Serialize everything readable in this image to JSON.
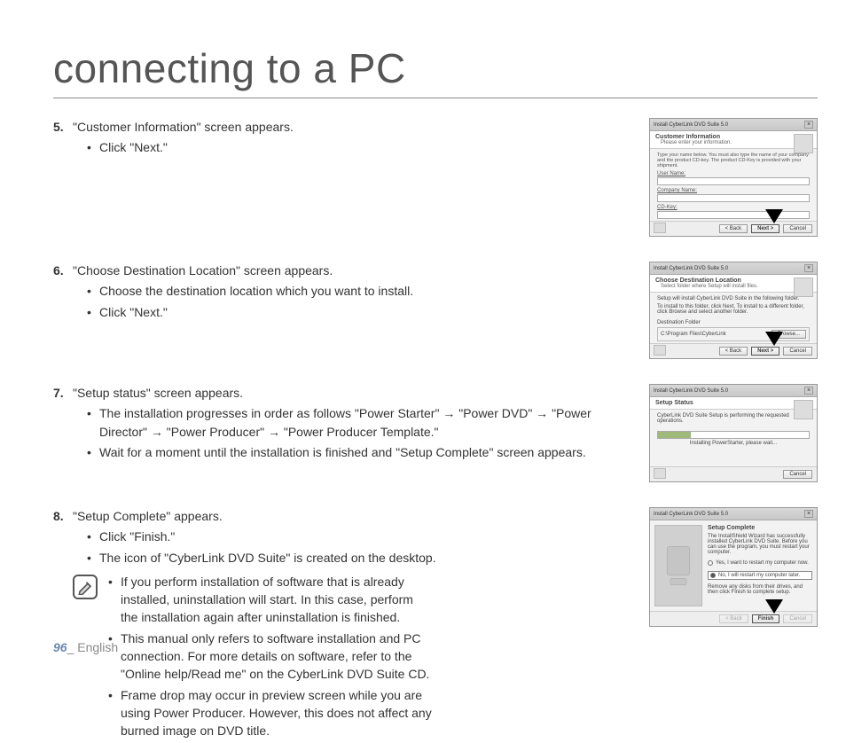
{
  "page": {
    "title": "connecting to a PC",
    "number": "96",
    "lang": "_ English"
  },
  "steps": {
    "s5": {
      "num": "5.",
      "head": "\"Customer Information\" screen appears.",
      "b1": "Click \"Next.\""
    },
    "s6": {
      "num": "6.",
      "head": "\"Choose Destination Location\" screen appears.",
      "b1": "Choose the destination location which you want to install.",
      "b2": "Click \"Next.\""
    },
    "s7": {
      "num": "7.",
      "head": "\"Setup status\" screen appears.",
      "b1": "The installation progresses in order as follows \"Power Starter\" → \"Power DVD\" → \"Power Director\" → \"Power Producer\" → \"Power Producer Template.\"",
      "b2": "Wait for a moment until the installation is finished and \"Setup Complete\" screen appears."
    },
    "s8": {
      "num": "8.",
      "head": "\"Setup Complete\" appears.",
      "b1": "Click \"Finish.\"",
      "b2": "The icon of \"CyberLink DVD Suite\" is created on the desktop."
    }
  },
  "notes": {
    "n1": "If you perform installation of software that is already installed, uninstallation will start. In this case, perform the installation again after uninstallation is finished.",
    "n2": "This manual only refers to software installation and PC connection. For more details on software, refer to the \"Online help/Read me\" on the CyberLink DVD Suite CD.",
    "n3": "Frame drop may occur in preview screen while you are using Power Producer. However, this does not affect any burned image on DVD title."
  },
  "installer": {
    "window_title": "Install CyberLink DVD Suite 5.0",
    "btn_back": "< Back",
    "btn_next": "Next >",
    "btn_cancel": "Cancel",
    "btn_browse": "Browse...",
    "btn_finish": "Finish",
    "shot5": {
      "h1": "Customer Information",
      "h2": "Please enter your information.",
      "desc": "Type your name below. You must also type the name of your company and the product CD-key. The product CD-Key is provided with your shipment.",
      "f1": "User Name:",
      "f2": "Company Name:",
      "f3": "CD-Key:"
    },
    "shot6": {
      "h1": "Choose Destination Location",
      "h2": "Select folder where Setup will install files.",
      "l1": "Setup will install CyberLink DVD Suite in the following folder.",
      "l2": "To install to this folder, click Next. To install to a different folder, click Browse and select another folder.",
      "dest_label": "Destination Folder",
      "dest_path": "C:\\Program Files\\CyberLink"
    },
    "shot7": {
      "h1": "Setup Status",
      "l1": "CyberLink DVD Suite Setup is performing the requested operations.",
      "l2": "Installing PowerStarter, please wait..."
    },
    "shot8": {
      "title": "Setup Complete",
      "l1": "The InstallShield Wizard has successfully installed CyberLink DVD Suite. Before you can use the program, you must restart your computer.",
      "r1": "Yes, I want to restart my computer now.",
      "r2": "No, I will restart my computer later.",
      "l2": "Remove any disks from their drives, and then click Finish to complete setup."
    }
  }
}
